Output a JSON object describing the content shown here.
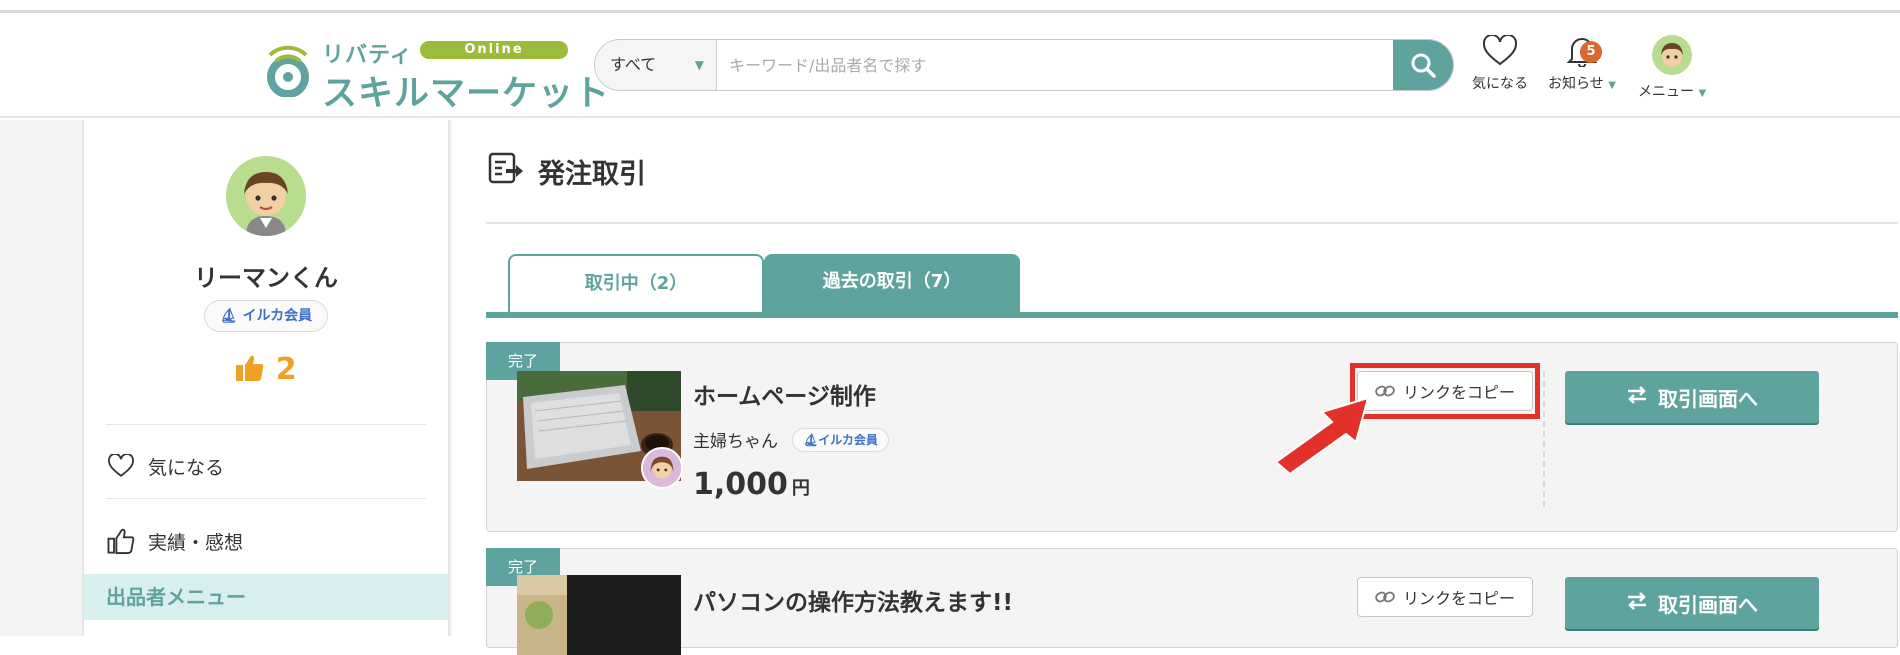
{
  "header": {
    "logo_top": "リバティ",
    "logo_online": "Online",
    "logo_main": "スキルマーケット",
    "search": {
      "category": "すべて",
      "placeholder": "キーワード/出品者名で探す"
    },
    "favorites_label": "気になる",
    "notifications_label": "お知らせ",
    "notifications_count": "5",
    "menu_label": "メニュー"
  },
  "sidebar": {
    "user_name": "リーマンくん",
    "member_badge": "イルカ会員",
    "likes_count": "2",
    "items": [
      {
        "label": "気になる",
        "icon": "heart-icon"
      },
      {
        "label": "実績・感想",
        "icon": "thumbs-up-icon"
      }
    ],
    "section_header": "出品者メニュー"
  },
  "main": {
    "page_title": "発注取引",
    "tabs": [
      {
        "label": "取引中（2）",
        "active": false
      },
      {
        "label": "過去の取引（7）",
        "active": true
      }
    ],
    "orders": [
      {
        "status": "完了",
        "title": "ホームページ制作",
        "seller": "主婦ちゃん",
        "seller_badge": "イルカ会員",
        "price": "1,000",
        "currency": "円",
        "copy_label": "リンクをコピー",
        "open_label": "取引画面へ"
      },
      {
        "status": "完了",
        "title": "パソコンの操作方法教えます!!",
        "copy_label": "リンクをコピー",
        "open_label": "取引画面へ"
      }
    ]
  },
  "colors": {
    "accent": "#5fa39e",
    "highlight": "#e2312a",
    "likes": "#f0a027",
    "badge": "#d9672e"
  }
}
